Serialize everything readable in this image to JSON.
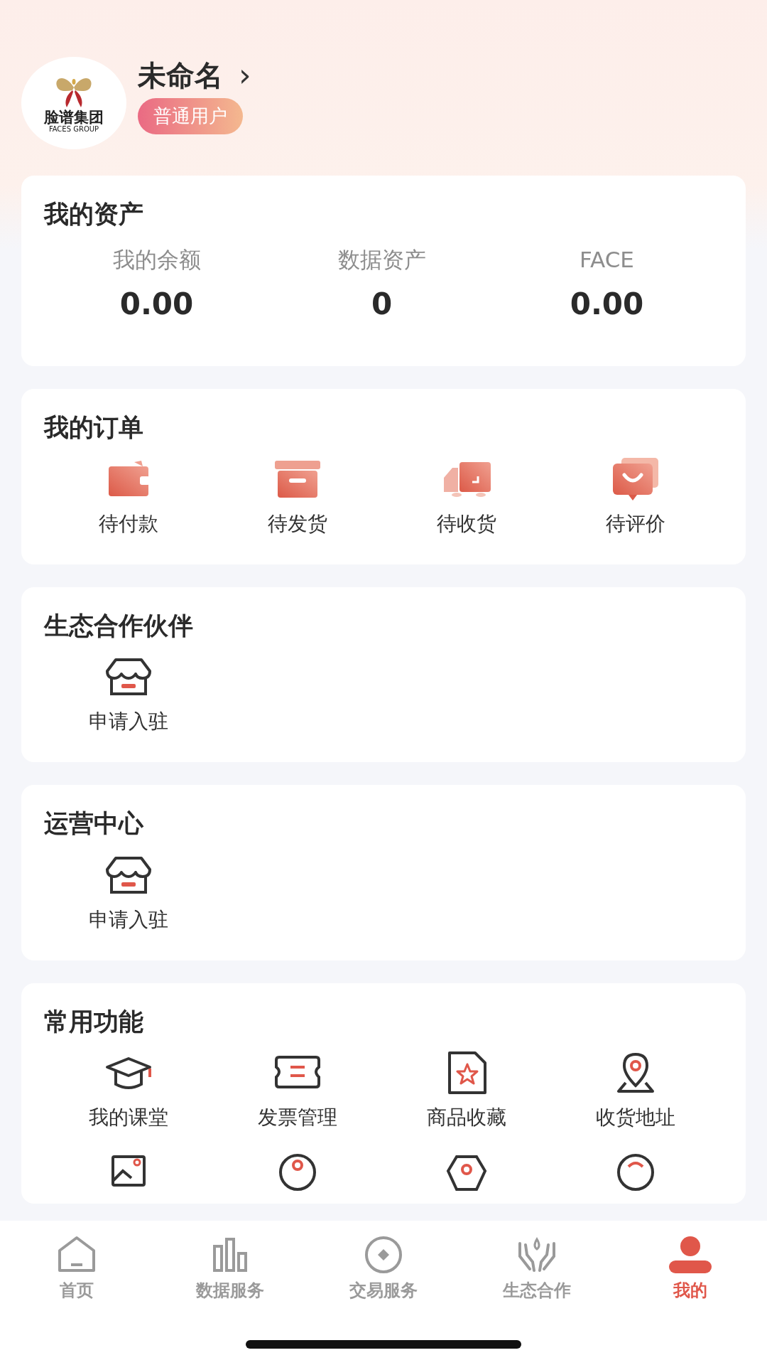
{
  "profile": {
    "logo_text": "脸谱集团",
    "logo_subtext": "FACES GROUP",
    "name": "未命名",
    "chevron": "›",
    "badge": "普通用户"
  },
  "assets": {
    "title": "我的资产",
    "items": [
      {
        "label": "我的余额",
        "value": "0.00"
      },
      {
        "label": "数据资产",
        "value": "0"
      },
      {
        "label": "FACE",
        "value": "0.00"
      }
    ]
  },
  "orders": {
    "title": "我的订单",
    "items": [
      {
        "kind": "wallet",
        "label": "待付款"
      },
      {
        "kind": "box",
        "label": "待发货"
      },
      {
        "kind": "truck",
        "label": "待收货"
      },
      {
        "kind": "review",
        "label": "待评价"
      }
    ]
  },
  "partners": {
    "title": "生态合作伙伴",
    "items": [
      {
        "kind": "store",
        "label": "申请入驻"
      }
    ]
  },
  "operations": {
    "title": "运营中心",
    "items": [
      {
        "kind": "store",
        "label": "申请入驻"
      }
    ]
  },
  "functions": {
    "title": "常用功能",
    "items": [
      {
        "kind": "cap",
        "label": "我的课堂"
      },
      {
        "kind": "ticket",
        "label": "发票管理"
      },
      {
        "kind": "star-doc",
        "label": "商品收藏"
      },
      {
        "kind": "pin",
        "label": "收货地址"
      }
    ]
  },
  "tab_bar": [
    {
      "kind": "home",
      "label": "首页",
      "selected": false
    },
    {
      "kind": "bars",
      "label": "数据服务",
      "selected": false
    },
    {
      "kind": "coin",
      "label": "交易服务",
      "selected": false
    },
    {
      "kind": "hands",
      "label": "生态合作",
      "selected": false
    },
    {
      "kind": "person",
      "label": "我的",
      "selected": true
    }
  ]
}
